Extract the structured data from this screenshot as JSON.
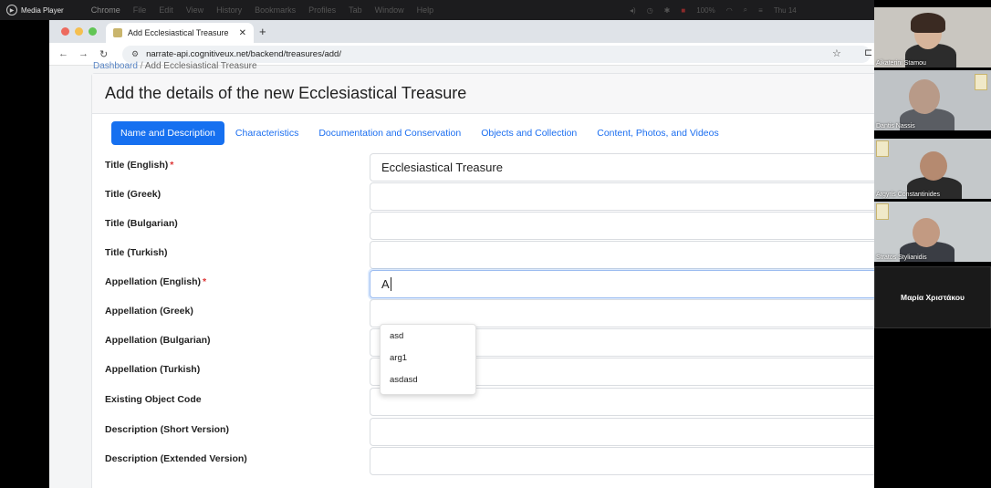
{
  "menubar": {
    "app_title": "Media Player",
    "menus": [
      "Chrome",
      "File",
      "Edit",
      "View",
      "History",
      "Bookmarks",
      "Profiles",
      "Tab",
      "Window",
      "Help"
    ],
    "battery": "100%",
    "clock": "Thu 14"
  },
  "browser": {
    "tab_title": "Add Ecclesiastical Treasure",
    "url": "narrate-api.cognitiveux.net/backend/treasures/add/"
  },
  "page": {
    "breadcrumb_home": "Dashboard",
    "breadcrumb_current": "Add Ecclesiastical Treasure",
    "title": "Add the details of the new Ecclesiastical Treasure",
    "tabs": [
      {
        "label": "Name and Description",
        "active": true
      },
      {
        "label": "Characteristics",
        "active": false
      },
      {
        "label": "Documentation and Conservation",
        "active": false
      },
      {
        "label": "Objects and Collection",
        "active": false
      },
      {
        "label": "Content, Photos, and Videos",
        "active": false
      }
    ],
    "fields": [
      {
        "label": "Title (English)",
        "required": "*",
        "value": "Ecclesiastical Treasure"
      },
      {
        "label": "Title (Greek)",
        "required": "",
        "value": ""
      },
      {
        "label": "Title (Bulgarian)",
        "required": "",
        "value": ""
      },
      {
        "label": "Title (Turkish)",
        "required": "",
        "value": ""
      },
      {
        "label": "Appellation (English)",
        "required": "*",
        "value": "A"
      },
      {
        "label": "Appellation (Greek)",
        "required": "",
        "value": ""
      },
      {
        "label": "Appellation (Bulgarian)",
        "required": "",
        "value": ""
      },
      {
        "label": "Appellation (Turkish)",
        "required": "",
        "value": ""
      },
      {
        "label": "Existing Object Code",
        "required": "",
        "value": ""
      },
      {
        "label": "Description (Short Version)",
        "required": "",
        "value": ""
      },
      {
        "label": "Description (Extended Version)",
        "required": "",
        "value": ""
      }
    ],
    "autocomplete": [
      "asd",
      "arg1",
      "asdasd"
    ]
  },
  "participants": [
    {
      "name": "Aikaterini Stamou"
    },
    {
      "name": "Dantis Nassis"
    },
    {
      "name": "Argyris Constantinides"
    },
    {
      "name": "Stratos Stylianidis"
    },
    {
      "name": "Μαρία Χριστάκου"
    }
  ],
  "colors": {
    "accent": "#1670f0",
    "required": "#dd3333",
    "menubar": "#1c1c1e"
  }
}
